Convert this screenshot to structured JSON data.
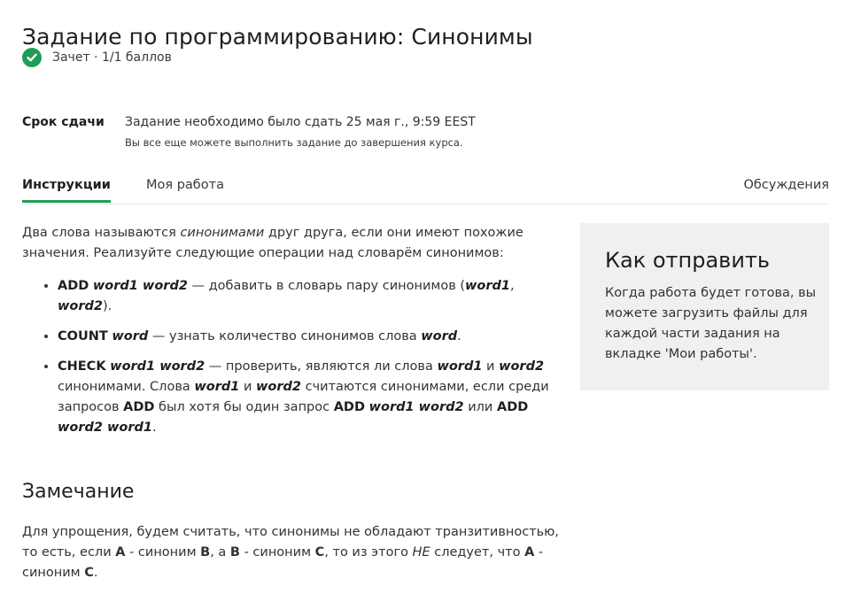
{
  "page_title": "Задание по программированию: Синонимы",
  "grade": {
    "text": "Зачет · 1/1 баллов",
    "status_color": "#1f9d55"
  },
  "deadline": {
    "label": "Срок сдачи",
    "main": "Задание необходимо было сдать 25 мая г., 9:59 EEST",
    "note": "Вы все еще можете выполнить задание до завершения курса."
  },
  "tabs": {
    "instructions": "Инструкции",
    "my_work": "Моя работа",
    "discussions": "Обсуждения"
  },
  "intro": {
    "before": "Два слова называются ",
    "emph": "синонимами",
    "after": " друг друга, если они имеют похожие значения. Реализуйте следующие операции над словарём синонимов:"
  },
  "operations": {
    "add": {
      "cmd": "ADD",
      "args": "word1 word2",
      "desc": " — добавить в словарь пару синонимов (",
      "a1": "word1",
      "sep": ", ",
      "a2": "word2",
      "end": ")."
    },
    "count": {
      "cmd": "COUNT",
      "args": "word",
      "desc": " — узнать количество синонимов слова ",
      "a1": "word",
      "end": "."
    },
    "check": {
      "cmd": "CHECK",
      "args": "word1 word2",
      "t1": " — проверить, являются ли слова ",
      "a1": "word1",
      "t2": " и ",
      "a2": "word2",
      "t3": " синонимами. Слова ",
      "a3": "word1",
      "t4": " и ",
      "a4": "word2",
      "t5": " считаются синонимами, если среди запросов ",
      "k1": "ADD",
      "t6": " был хотя бы один запрос ",
      "k2": "ADD",
      "a5": "word1 word2",
      "t7": " или ",
      "k3": "ADD",
      "a6": "word2 word1",
      "end": "."
    }
  },
  "remark": {
    "title": "Замечание",
    "t1": "Для упрощения, будем считать, что синонимы не обладают транзитивностью, то есть, если ",
    "A1": "A",
    "t2": " - синоним ",
    "B1": "B",
    "t3": ", а ",
    "B2": "B",
    "t4": " - синоним ",
    "C1": "C",
    "t5": ", то из этого ",
    "not": "НЕ",
    "t6": " следует, что ",
    "A2": "A",
    "t7": " - синоним ",
    "C2": "C",
    "end": "."
  },
  "how_to_submit": {
    "title": "Как отправить",
    "text": "Когда работа будет готова, вы можете загрузить файлы для каждой части задания на вкладке 'Мои работы'."
  }
}
